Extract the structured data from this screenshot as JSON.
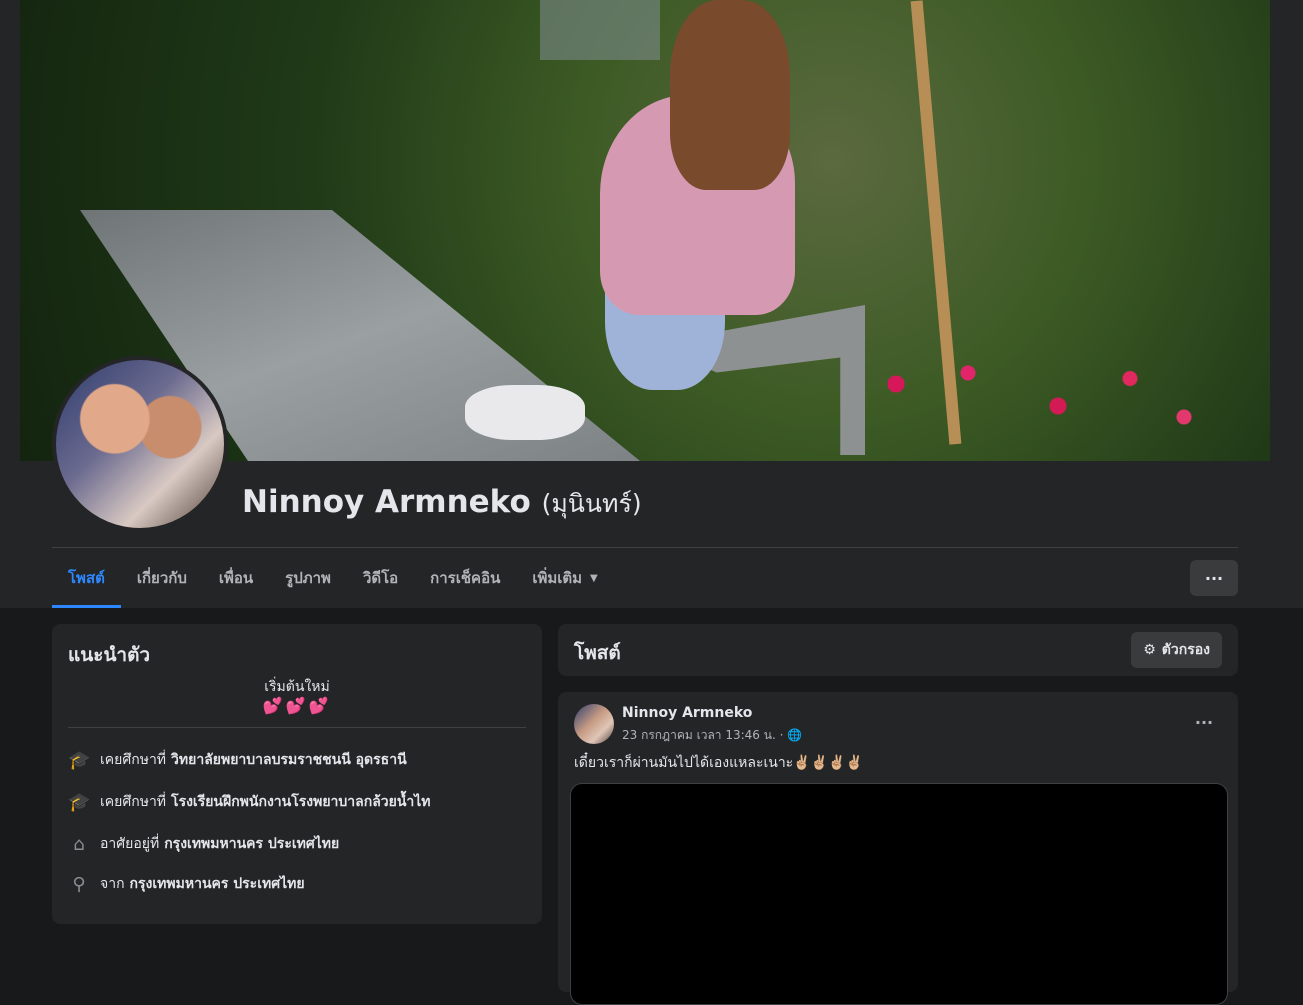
{
  "profile": {
    "name": "Ninnoy Armneko",
    "alternate_name": "(มุนินทร์)"
  },
  "tabs": [
    {
      "label": "โพสต์",
      "active": true
    },
    {
      "label": "เกี่ยวกับ"
    },
    {
      "label": "เพื่อน"
    },
    {
      "label": "รูปภาพ"
    },
    {
      "label": "วิดีโอ"
    },
    {
      "label": "การเช็คอิน"
    },
    {
      "label": "เพิ่มเติม",
      "caret": "▼"
    }
  ],
  "more_button": "···",
  "intro": {
    "title": "แนะนำตัว",
    "bio": "เริ่มต้นใหม่",
    "bio_emoji": "💕💕💕",
    "items": [
      {
        "icon": "graduation-cap-icon",
        "prefix": "เคยศึกษาที่",
        "value": "วิทยาลัยพยาบาลบรมราชชนนี อุดรธานี"
      },
      {
        "icon": "graduation-cap-icon",
        "prefix": "เคยศึกษาที่",
        "value": "โรงเรียนฝึกพนักงานโรงพยาบาลกล้วยน้ำไท"
      },
      {
        "icon": "home-icon",
        "prefix": "อาศัยอยู่ที่",
        "value": "กรุงเทพมหานคร ประเทศไทย"
      },
      {
        "icon": "location-pin-icon",
        "prefix": "จาก",
        "value": "กรุงเทพมหานคร ประเทศไทย"
      }
    ]
  },
  "posts_section": {
    "title": "โพสต์",
    "filter_label": "ตัวกรอง"
  },
  "post": {
    "author": "Ninnoy Armneko",
    "timestamp": "23 กรกฎาคม เวลา 13:46 น. ·",
    "privacy_icon": "globe-icon",
    "dots": "···",
    "text": "เดี๋ยวเราก็ผ่านมันไปได้เองแหละเนาะ✌🏼✌🏼✌🏼✌🏼"
  },
  "colors": {
    "background": "#18191a",
    "card": "#242526",
    "accent": "#2d88ff",
    "text": "#e4e6eb",
    "secondary_text": "#b0b3b8"
  }
}
